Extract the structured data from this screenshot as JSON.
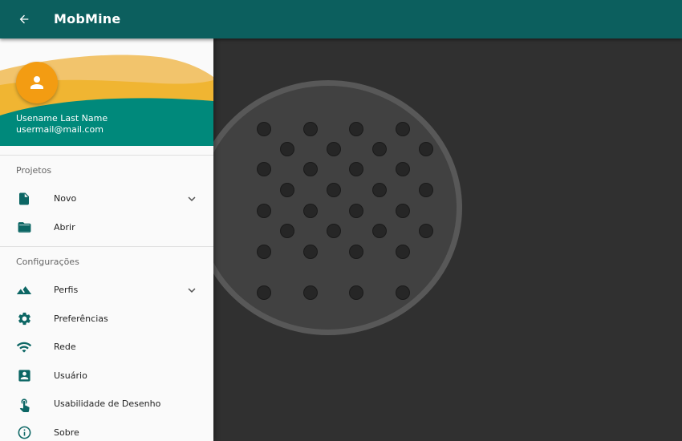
{
  "appbar": {
    "title": "MobMine",
    "back_icon": "arrow-back-icon",
    "color": "#0c5f5e"
  },
  "drawer": {
    "header": {
      "user_name": "Usename Last Name",
      "user_email": "usermail@mail.com",
      "avatar_icon": "person-icon",
      "avatar_color": "#f39c12",
      "accent": "#00897b"
    },
    "sections": [
      {
        "label": "Projetos",
        "items": [
          {
            "label": "Novo",
            "icon": "file-icon",
            "expandable": true
          },
          {
            "label": "Abrir",
            "icon": "folder-open-icon",
            "expandable": false
          }
        ]
      },
      {
        "label": "Configurações",
        "items": [
          {
            "label": "Perfis",
            "icon": "terrain-icon",
            "expandable": true
          },
          {
            "label": "Preferências",
            "icon": "gear-icon",
            "expandable": false
          },
          {
            "label": "Rede",
            "icon": "wifi-icon",
            "expandable": false
          },
          {
            "label": "Usuário",
            "icon": "account-box-icon",
            "expandable": false
          },
          {
            "label": "Usabilidade de Desenho",
            "icon": "touch-icon",
            "expandable": false
          },
          {
            "label": "Sobre",
            "icon": "info-icon",
            "expandable": false
          }
        ]
      }
    ]
  }
}
